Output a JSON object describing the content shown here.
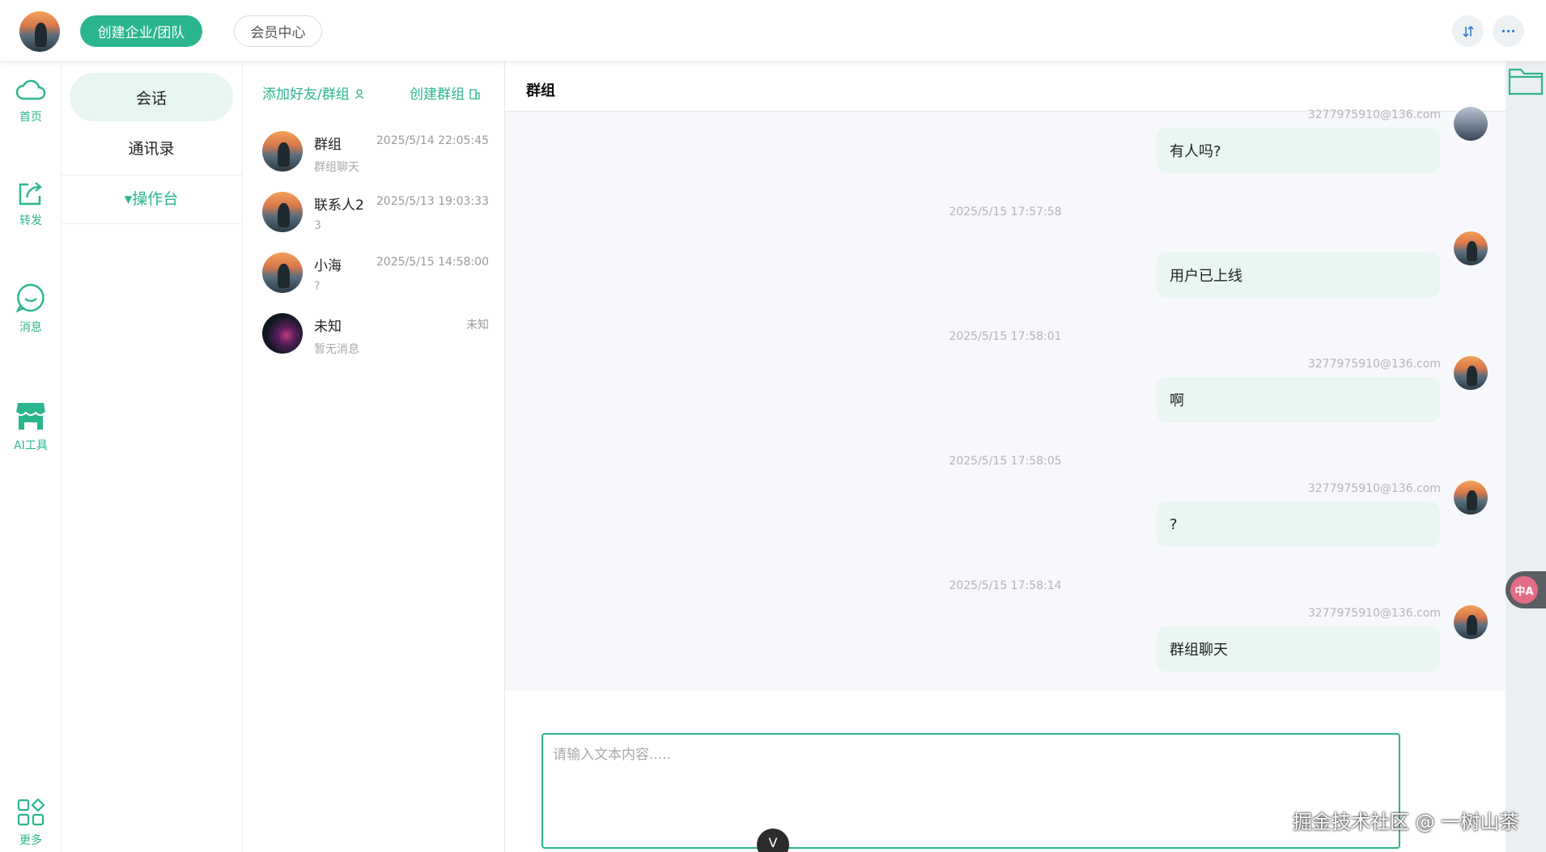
{
  "topbar": {
    "create_team_label": "创建企业/团队",
    "member_center_label": "会员中心",
    "ellipsis_label": "···"
  },
  "rail": {
    "items": [
      {
        "label": "首页",
        "icon": "cloud-icon"
      },
      {
        "label": "转发",
        "icon": "share-icon"
      },
      {
        "label": "消息",
        "icon": "message-icon"
      },
      {
        "label": "AI工具",
        "icon": "store-icon"
      },
      {
        "label": "更多",
        "icon": "grid-icon"
      }
    ]
  },
  "subnav": {
    "items": [
      {
        "label": "会话",
        "active": true
      },
      {
        "label": "通讯录",
        "active": false
      }
    ],
    "console_label": "▾操作台"
  },
  "convlist": {
    "add_friend_label": "添加好友/群组",
    "create_group_label": "创建群组",
    "conversations": [
      {
        "name": "群组",
        "time": "2025/5/14 22:05:45",
        "preview": "群组聊天"
      },
      {
        "name": "联系人2",
        "time": "2025/5/13 19:03:33",
        "preview": "3"
      },
      {
        "name": "小海",
        "time": "2025/5/15 14:58:00",
        "preview": "?"
      },
      {
        "name": "未知",
        "time": "未知",
        "preview": "暂无消息"
      }
    ]
  },
  "chat": {
    "title": "群组",
    "messages": [
      {
        "email": "3277975910@136.com",
        "text": "有人吗?"
      },
      {
        "time": "2025/5/15 17:57:58"
      },
      {
        "email": "",
        "text": "用户已上线"
      },
      {
        "time": "2025/5/15 17:58:01"
      },
      {
        "email": "3277975910@136.com",
        "text": "啊"
      },
      {
        "time": "2025/5/15 17:58:05"
      },
      {
        "email": "3277975910@136.com",
        "text": "?"
      },
      {
        "time": "2025/5/15 17:58:14"
      },
      {
        "email": "3277975910@136.com",
        "text": "群组聊天"
      }
    ],
    "input_placeholder": "请输入文本内容....."
  },
  "overlay": {
    "translate_label": "中A",
    "watermark": "掘金技术社区 @ 一树山茶",
    "vue_label": "V"
  },
  "colors": {
    "accent": "#2bb58f",
    "bubble": "#e9f6f1",
    "active_nav": "#e7f6f0"
  }
}
